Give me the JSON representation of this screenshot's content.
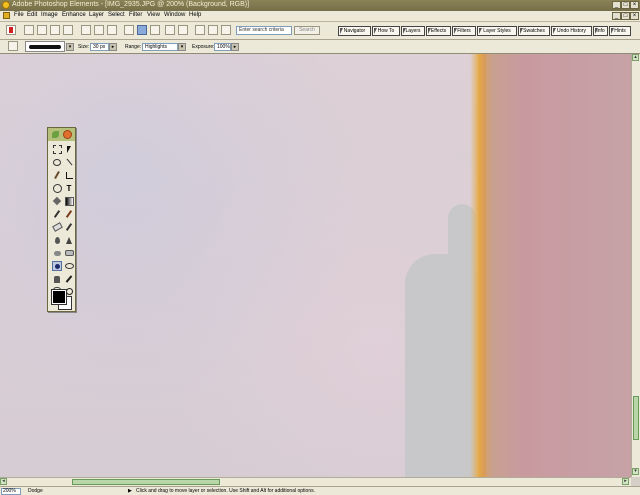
{
  "window": {
    "title": "Adobe Photoshop Elements - [IMG_2935.JPG @ 200% (Background, RGB)]"
  },
  "menu": [
    "File",
    "Edit",
    "Image",
    "Enhance",
    "Layer",
    "Select",
    "Filter",
    "View",
    "Window",
    "Help"
  ],
  "shortcuts": {
    "search_placeholder": "Enter search criteria",
    "search_button": "Search"
  },
  "palette_tabs": [
    "Navigator",
    "How To",
    "Layers",
    "Effects",
    "Filters",
    "Layer Styles",
    "Swatches",
    "Undo History",
    "Info",
    "Hints"
  ],
  "options": {
    "size_label": "Size:",
    "size_value": "30 px",
    "range_label": "Range:",
    "range_value": "Highlights",
    "exposure_label": "Exposure:",
    "exposure_value": "100%"
  },
  "status": {
    "zoom": "200%",
    "tool": "Dodge",
    "hint": "Click and drag to move layer or selection.  Use Shift and Alt for additional options."
  },
  "colors": {
    "foreground": "#000000",
    "background": "#ffffff"
  }
}
